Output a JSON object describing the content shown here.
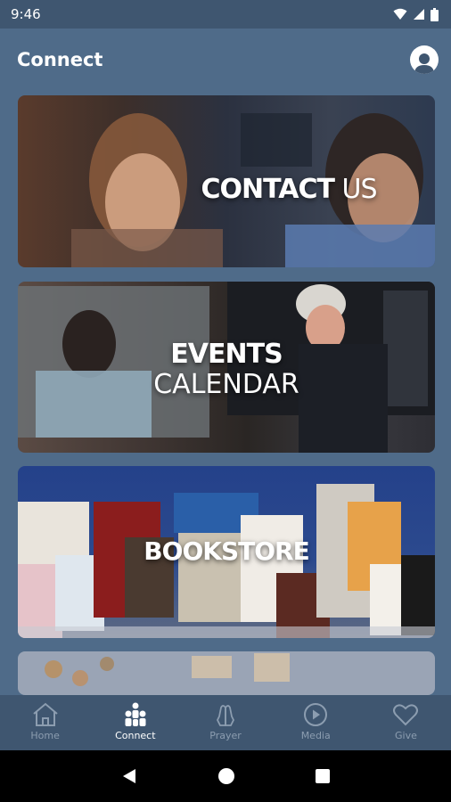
{
  "status_bar": {
    "time": "9:46"
  },
  "header": {
    "title": "Connect"
  },
  "cards": {
    "contact": {
      "title_bold": "CONTACT",
      "title_regular": " US"
    },
    "events": {
      "line1": "EVENTS",
      "line2": "CALENDAR"
    },
    "bookstore": {
      "title": "BOOKSTORE"
    }
  },
  "bottom_nav": {
    "items": [
      {
        "label": "Home",
        "icon": "home-icon"
      },
      {
        "label": "Connect",
        "icon": "people-icon"
      },
      {
        "label": "Prayer",
        "icon": "praying-hands-icon"
      },
      {
        "label": "Media",
        "icon": "play-circle-icon"
      },
      {
        "label": "Give",
        "icon": "heart-icon"
      }
    ],
    "active": "Connect"
  },
  "colors": {
    "background": "#4f6b89",
    "bar": "#3f5670",
    "nav_inactive": "#8c9db0"
  }
}
